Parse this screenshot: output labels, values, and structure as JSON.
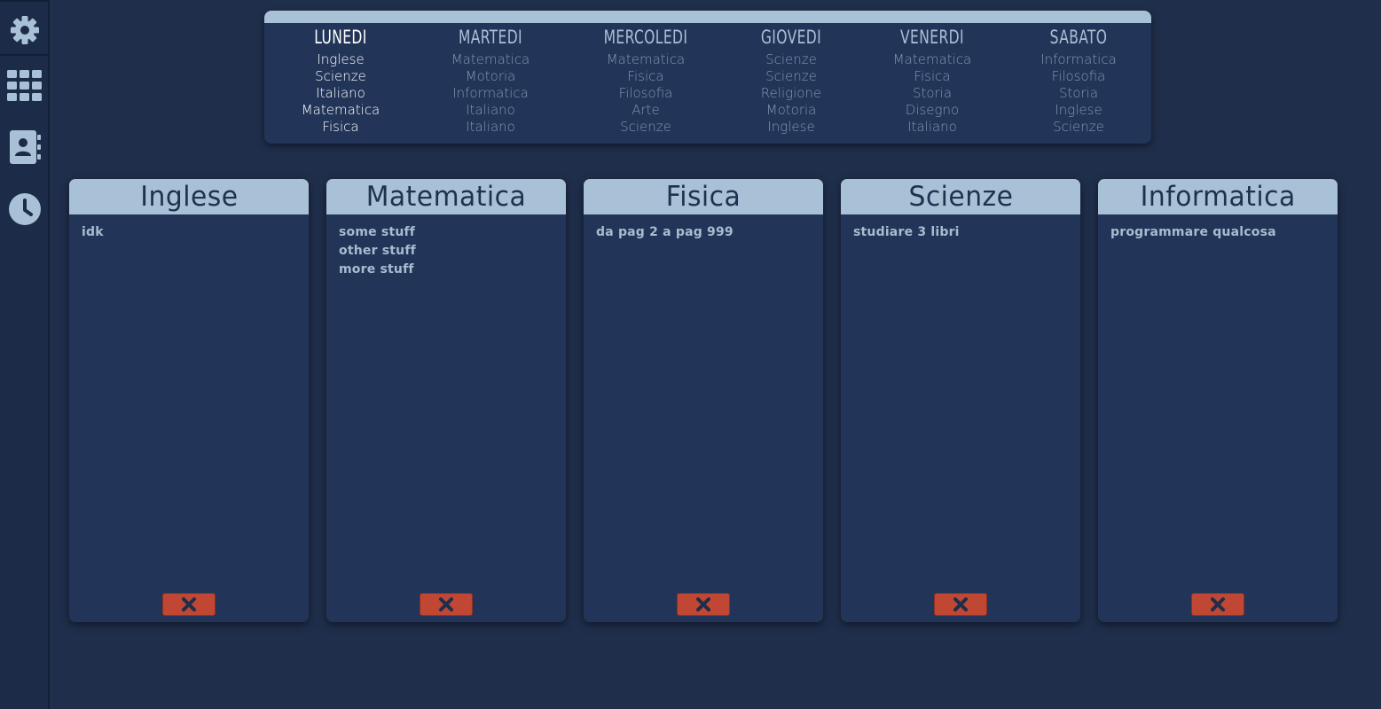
{
  "sidebar": {
    "items": [
      {
        "icon": "gear-icon"
      },
      {
        "icon": "grid-icon"
      },
      {
        "icon": "contact-book-icon"
      },
      {
        "icon": "clock-icon"
      }
    ]
  },
  "timetable": {
    "days": [
      {
        "name": "LUNEDI",
        "active": true,
        "lessons": [
          "Inglese",
          "Scienze",
          "Italiano",
          "Matematica",
          "Fisica"
        ]
      },
      {
        "name": "MARTEDI",
        "active": false,
        "lessons": [
          "Matematica",
          "Motoria",
          "Informatica",
          "Italiano",
          "Italiano"
        ]
      },
      {
        "name": "MERCOLEDI",
        "active": false,
        "lessons": [
          "Matematica",
          "Fisica",
          "Filosofia",
          "Arte",
          "Scienze"
        ]
      },
      {
        "name": "GIOVEDI",
        "active": false,
        "lessons": [
          "Scienze",
          "Scienze",
          "Religione",
          "Motoria",
          "Inglese"
        ]
      },
      {
        "name": "VENERDI",
        "active": false,
        "lessons": [
          "Matematica",
          "Fisica",
          "Storia",
          "Disegno",
          "Italiano"
        ]
      },
      {
        "name": "SABATO",
        "active": false,
        "lessons": [
          "Informatica",
          "Filosofia",
          "Storia",
          "Inglese",
          "Scienze"
        ]
      }
    ]
  },
  "cards": [
    {
      "title": "Inglese",
      "lines": [
        "idk"
      ]
    },
    {
      "title": "Matematica",
      "lines": [
        "some stuff",
        "other stuff",
        "more stuff"
      ]
    },
    {
      "title": "Fisica",
      "lines": [
        "da pag 2 a pag 999"
      ]
    },
    {
      "title": "Scienze",
      "lines": [
        "studiare 3 libri"
      ]
    },
    {
      "title": "Informatica",
      "lines": [
        "programmare qualcosa"
      ]
    }
  ],
  "colors": {
    "background": "#1f2e4b",
    "panel": "#223558",
    "accent": "#a8c1d6",
    "delete": "#c04733",
    "dark_text": "#1f3150"
  }
}
